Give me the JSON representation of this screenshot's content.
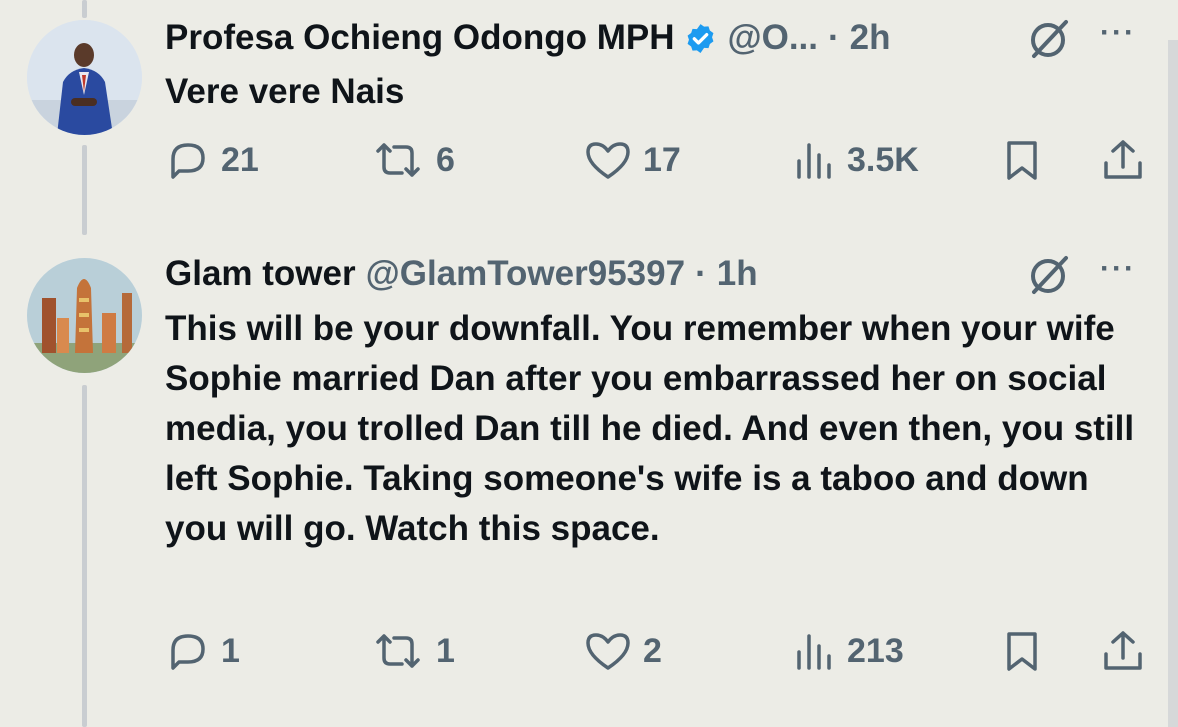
{
  "tweets": [
    {
      "name": "Profesa Ochieng Odongo MPH",
      "handle": "@O...",
      "dot": "·",
      "time": "2h",
      "text": "Vere vere Nais",
      "replies": "21",
      "reposts": "6",
      "likes": "17",
      "views": "3.5K",
      "verified": true
    },
    {
      "name": "Glam tower",
      "handle": "@GlamTower95397",
      "dot": "·",
      "time": "1h",
      "text": "This will be your downfall. You remember when your wife Sophie married Dan after you embarrassed her on social media, you trolled Dan till he died. And even then, you still left Sophie. Taking someone's wife is a taboo and down you will go. Watch this space.",
      "replies": "1",
      "reposts": "1",
      "likes": "2",
      "views": "213",
      "verified": false
    }
  ],
  "more_symbol": "···",
  "colors": {
    "background": "#ecece6",
    "text": "#0f1419",
    "muted": "#536471",
    "verified": "#1d9bf0",
    "thread": "#c9cdd1"
  },
  "icons": [
    "reply-icon",
    "repost-icon",
    "like-icon",
    "views-icon",
    "bookmark-icon",
    "share-icon",
    "grok-icon",
    "more-icon",
    "verified-badge-icon"
  ]
}
